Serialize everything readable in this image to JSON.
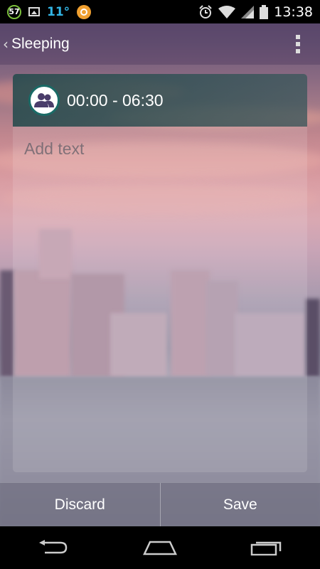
{
  "status_bar": {
    "notification_count": "57",
    "temperature": "11°",
    "time": "13:38",
    "icons": [
      "notification-badge-icon",
      "image-icon",
      "orange-app-icon",
      "alarm-icon",
      "wifi-icon",
      "signal-icon",
      "battery-icon"
    ]
  },
  "action_bar": {
    "title": "Sleeping",
    "icons": [
      "chevron-left-icon",
      "overflow-menu-icon"
    ]
  },
  "card": {
    "time_range": "00:00 - 06:30",
    "text_placeholder": "Add text",
    "text_value": "",
    "avatar_icon": "group-icon",
    "accent_color": "#1a6b66"
  },
  "buttons": {
    "discard_label": "Discard",
    "save_label": "Save"
  },
  "nav_bar": {
    "icons": [
      "back-icon",
      "home-icon",
      "recents-icon"
    ]
  }
}
